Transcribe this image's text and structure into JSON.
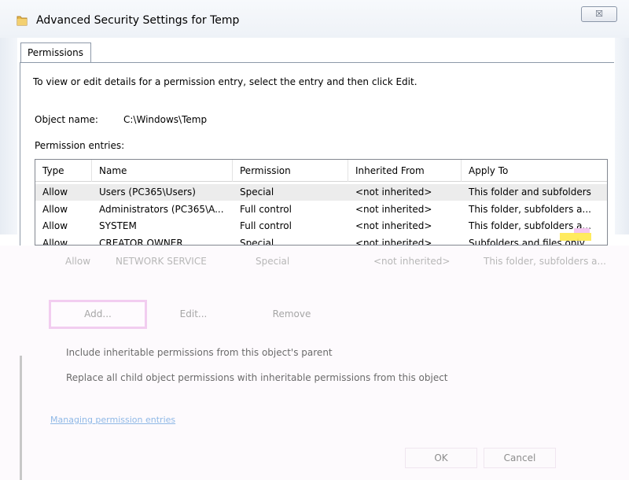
{
  "window": {
    "title": "Advanced Security Settings for Temp",
    "close_label": "☒"
  },
  "tab": {
    "label": "Permissions"
  },
  "intro_text": "To view or edit details for a permission entry, select the entry and then click Edit.",
  "object": {
    "label": "Object name:",
    "value": "C:\\Windows\\Temp"
  },
  "entries": {
    "label": "Permission entries:",
    "columns": [
      "Type",
      "Name",
      "Permission",
      "Inherited From",
      "Apply To"
    ],
    "rows": [
      {
        "type": "Allow",
        "name": "Users (PC365\\Users)",
        "permission": "Special",
        "inherited": "<not inherited>",
        "apply": "This folder and subfolders"
      },
      {
        "type": "Allow",
        "name": "Administrators (PC365\\A...",
        "permission": "Full control",
        "inherited": "<not inherited>",
        "apply": "This folder, subfolders a..."
      },
      {
        "type": "Allow",
        "name": "SYSTEM",
        "permission": "Full control",
        "inherited": "<not inherited>",
        "apply": "This folder, subfolders a..."
      },
      {
        "type": "Allow",
        "name": "CREATOR OWNER",
        "permission": "Special",
        "inherited": "<not inherited>",
        "apply": "Subfolders and files only"
      },
      {
        "type": "Allow",
        "name": "NETWORK SERVICE",
        "permission": "Special",
        "inherited": "<not inherited>",
        "apply": "This folder, subfolders a..."
      }
    ]
  },
  "buttons": {
    "add": "Add...",
    "edit": "Edit...",
    "remove": "Remove",
    "ok": "OK",
    "cancel": "Cancel"
  },
  "options": {
    "include_inheritable": "Include inheritable permissions from this object's parent",
    "replace_child": "Replace all child object permissions with inheritable permissions from this object"
  },
  "link": "Managing permission entries",
  "icons": {
    "title": "folder-icon",
    "close": "close-icon"
  }
}
